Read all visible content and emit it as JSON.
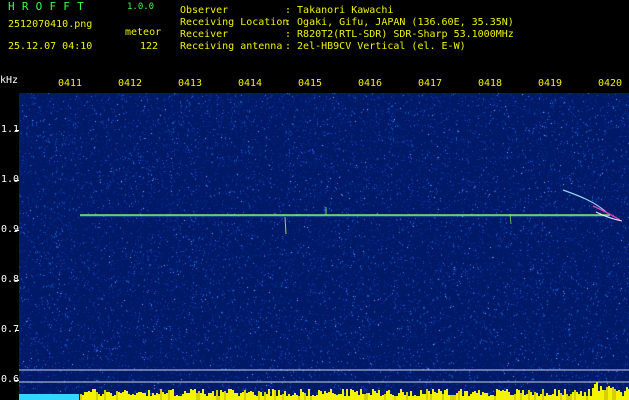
{
  "header": {
    "app_title": "HROFFT",
    "app_version": "1.0.0",
    "file_name": "2512070410.png",
    "meteor_label": "meteor",
    "timestamp": "25.12.07 04:10",
    "meteor_count": "122",
    "info": [
      {
        "label": "Observer",
        "value": ": Takanori Kawachi"
      },
      {
        "label": "Receiving Location",
        "value": ": Ogaki, Gifu, JAPAN (136.60E, 35.35N)"
      },
      {
        "label": "Receiver",
        "value": ": R820T2(RTL-SDR) SDR-Sharp 53.1000MHz"
      },
      {
        "label": "Receiving antenna",
        "value": ": 2el-HB9CV Vertical (el. E-W)"
      }
    ]
  },
  "axes": {
    "x_ticks": [
      "0411",
      "0412",
      "0413",
      "0414",
      "0415",
      "0416",
      "0417",
      "0418",
      "0419",
      "0420"
    ],
    "y_unit": "kHz",
    "y_ticks": [
      "1.1",
      "1.0",
      "0.9",
      "0.8",
      "0.7",
      "0.6"
    ]
  },
  "colors": {
    "text_yellow": "#f2f200",
    "text_green": "#31ff4a",
    "text_white": "#ffffff",
    "plot_background": "#001a68"
  }
}
